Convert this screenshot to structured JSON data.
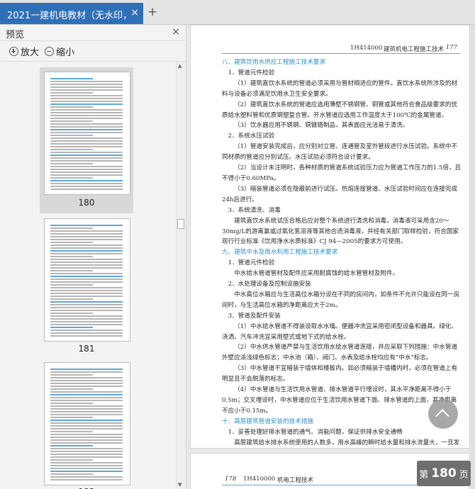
{
  "tab": {
    "title": "2021一建机电教材（无水印，可",
    "close": "×",
    "new": "+"
  },
  "sidebar": {
    "title": "预览",
    "close": "×",
    "zoom_in": "放大",
    "zoom_out": "缩小",
    "thumbs": [
      {
        "label": "180",
        "selected": true
      },
      {
        "label": "181",
        "selected": false
      },
      {
        "label": "182",
        "selected": false
      }
    ]
  },
  "page": {
    "header_code": "1H414000",
    "header_title": "建筑机电工程施工技术",
    "header_num": "177",
    "paragraphs": [
      {
        "text": "八、建筑饮用水供应工程施工技术要求",
        "style": "sec"
      },
      {
        "text": "1．管道元件检验",
        "style": "ind1"
      },
      {
        "text": "（1）建筑直饮水系统的管道必须采用与管材相适应的管件。直饮水系统所涉及的材料与设备必须满足饮用水卫生安全要求。",
        "style": "ind"
      },
      {
        "text": "（2）建筑直饮水系统的管道应选用薄壁不锈钢管、铜管或其他符合食品级要求的优质给水塑料管和优质钢塑复合管。开水管道应选用工作温度大于100℃的金属管道。",
        "style": "ind"
      },
      {
        "text": "（3）饮水器应用不锈钢、铜镀铬制品，其表面应光洁易于清洗。",
        "style": "ind"
      },
      {
        "text": "2．系统水压试验",
        "style": "ind1"
      },
      {
        "text": "（1）管道安装完成后，应分别对立管、连通管及室外管段进行水压试验。系统中不同材质的管道应分别试压。水压试验必须符合设计要求。",
        "style": "ind"
      },
      {
        "text": "（2）当设计未注明时，各种材质的管道系统试验压力应为管道工作压力的1.5倍，且不得小于0.60MPa。",
        "style": "ind"
      },
      {
        "text": "（3）暗装管道必须在隐蔽前进行试压。热熔连接管道、水压试验时间应在连接完成24h后进行。",
        "style": "ind"
      },
      {
        "text": "3．系统清洗、消毒",
        "style": "ind1"
      },
      {
        "text": "建筑直饮水系统试压合格后应对整个系统进行清洗和消毒，消毒液可采用含20～30mg/L的游离氯或过氧化氢溶液等其他合适消毒液，并经有关部门取样检验，符合国家现行行业标准《饮用净水水质标准》CJ 94—2005的要求方可使用。",
        "style": "ind"
      },
      {
        "text": "九、建筑中水及雨水利用工程施工技术要求",
        "style": "sec"
      },
      {
        "text": "1．管道元件检验",
        "style": "ind1"
      },
      {
        "text": "中水给水管道管材及配件应采用耐腐蚀的给水管管材及附件。",
        "style": "ind"
      },
      {
        "text": "2．水处理设备及控制设施安装",
        "style": "ind1"
      },
      {
        "text": "中水高位水箱应与生活高位水箱分设在不同的房间内，如条件不允许只能设在同一房间时，与生活高位水箱的净距离应大于2m。",
        "style": "ind"
      },
      {
        "text": "3．管道及配件安装",
        "style": "ind1"
      },
      {
        "text": "（1）中水给水管道不得装设取水水嘴。便器冲洗宜采用密闭型设备和器具。绿化、浇洒、汽车冲洗宜采用壁式或地下式的给水栓。",
        "style": "ind"
      },
      {
        "text": "（2）中水供水管道严禁与生活饮用水给水管道连接，并应采取下列措施：中水管道外壁应涂浅绿色标志；中水池（箱）、阀门、水表及给水栓均应有“中水”标志。",
        "style": "ind"
      },
      {
        "text": "（3）中水管道不宜暗装于墙体和楼板内。如必须暗装于墙槽内时，必须在管道上有明显且不会脱落的标志。",
        "style": "ind"
      },
      {
        "text": "（4）中水管道与生活饮用水管道、排水管道平行埋设时，其水平净距离不得小于0.5m；交叉埋设时，中水管道应位于生活饮用水管道下面、排水管道的上面，其净距离不应小于0.15m。",
        "style": "ind"
      },
      {
        "text": "十、高层建筑管道安装的技术措施",
        "style": "sec"
      },
      {
        "text": "1．妥善处理好排水管道的通气、消能问题，保证供排水安全通畅",
        "style": "ind1"
      },
      {
        "text": "高层建筑给水排水系统使用的人数多，用水高峰的瞬时给水量和排水流量大，一旦发生停水和排水管道堵塞事故，影响范围较大。妥善处理好排水管道的通气问题，保证供排水安全通畅是关键。十层及十层以上高层建筑卫生间的生活污水立管应设置通气立管，高",
        "style": "ind"
      }
    ],
    "footer_num": "178",
    "footer_code": "1H410000",
    "footer_title": "机电工程技术"
  },
  "page_badge": {
    "prefix": "第",
    "num": "180",
    "suffix": "页"
  },
  "colors": {
    "accent": "#2e6fb7",
    "section_blue": "#2d8fd0"
  }
}
